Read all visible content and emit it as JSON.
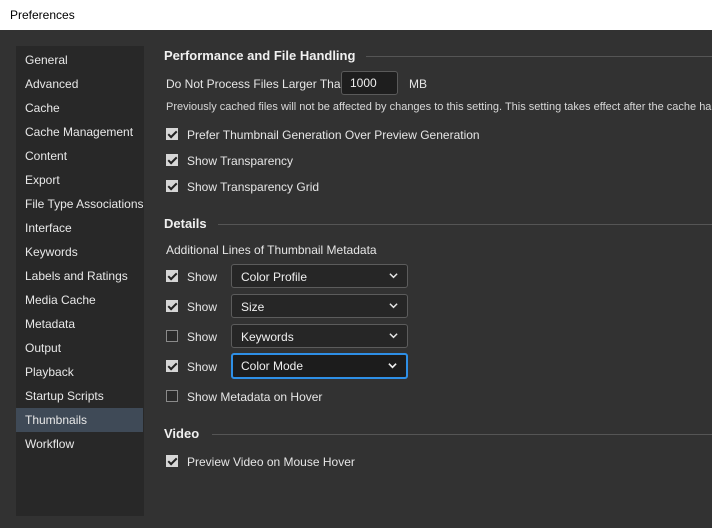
{
  "window": {
    "title": "Preferences"
  },
  "sidebar": {
    "items": [
      {
        "label": "General",
        "selected": false
      },
      {
        "label": "Advanced",
        "selected": false
      },
      {
        "label": "Cache",
        "selected": false
      },
      {
        "label": "Cache Management",
        "selected": false
      },
      {
        "label": "Content",
        "selected": false
      },
      {
        "label": "Export",
        "selected": false
      },
      {
        "label": "File Type Associations",
        "selected": false
      },
      {
        "label": "Interface",
        "selected": false
      },
      {
        "label": "Keywords",
        "selected": false
      },
      {
        "label": "Labels and Ratings",
        "selected": false
      },
      {
        "label": "Media Cache",
        "selected": false
      },
      {
        "label": "Metadata",
        "selected": false
      },
      {
        "label": "Output",
        "selected": false
      },
      {
        "label": "Playback",
        "selected": false
      },
      {
        "label": "Startup Scripts",
        "selected": false
      },
      {
        "label": "Thumbnails",
        "selected": true
      },
      {
        "label": "Workflow",
        "selected": false
      }
    ]
  },
  "performance": {
    "heading": "Performance and File Handling",
    "max_size_label": "Do Not Process Files Larger Than",
    "max_size_value": "1000",
    "max_size_unit": "MB",
    "cache_note": "Previously cached files will not be affected by changes to this setting. This setting takes effect after the cache ha",
    "prefer_thumbnail": {
      "label": "Prefer Thumbnail Generation Over Preview Generation",
      "checked": true
    },
    "show_transparency": {
      "label": "Show Transparency",
      "checked": true
    },
    "show_transparency_grid": {
      "label": "Show Transparency Grid",
      "checked": true
    }
  },
  "details": {
    "heading": "Details",
    "metadata_lines_label": "Additional Lines of Thumbnail Metadata",
    "lines": [
      {
        "show_label": "Show",
        "checked": true,
        "value": "Color Profile"
      },
      {
        "show_label": "Show",
        "checked": true,
        "value": "Size"
      },
      {
        "show_label": "Show",
        "checked": false,
        "value": "Keywords"
      },
      {
        "show_label": "Show",
        "checked": true,
        "value": "Color Mode"
      }
    ],
    "show_metadata_hover": {
      "label": "Show Metadata on Hover",
      "checked": false
    }
  },
  "video": {
    "heading": "Video",
    "preview_on_hover": {
      "label": "Preview Video on Mouse Hover",
      "checked": true
    }
  },
  "colors": {
    "accent": "#2e8fe6",
    "selected_item": "#3f4a57",
    "panel": "#323232",
    "sidebar": "#282828"
  }
}
